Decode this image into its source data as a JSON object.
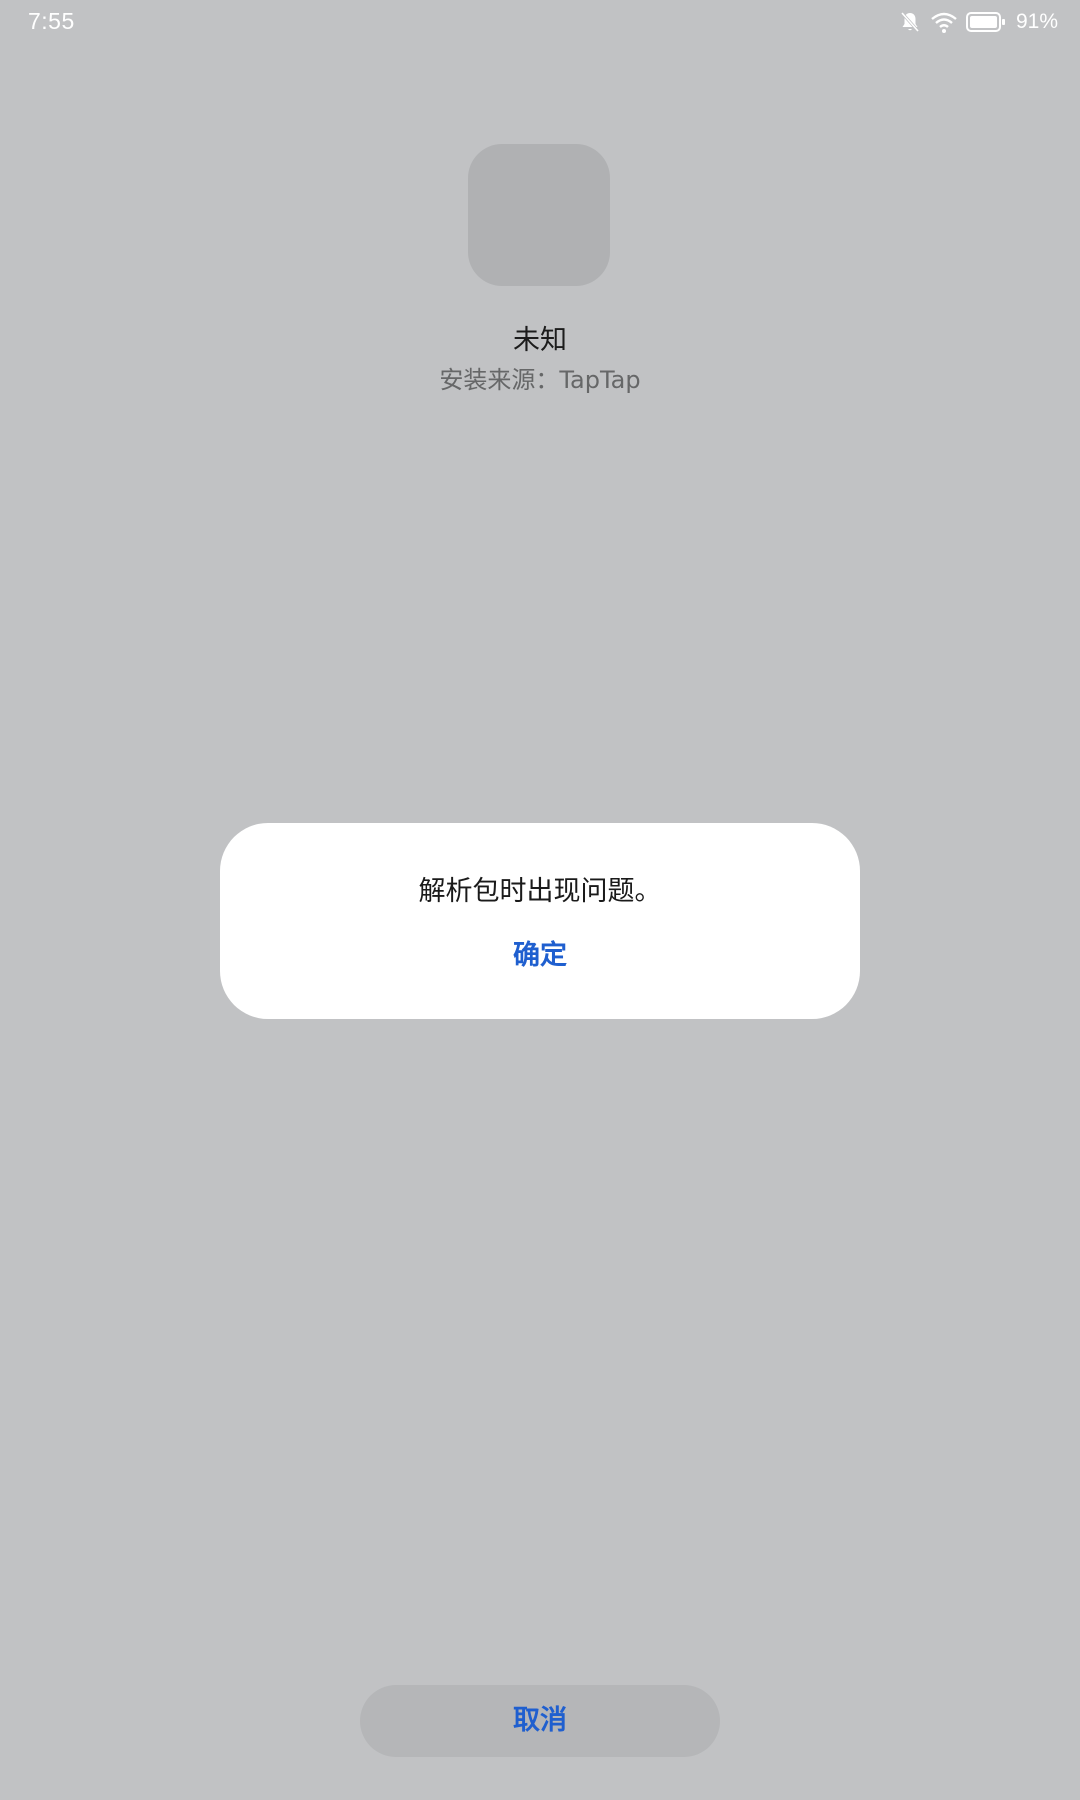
{
  "status_bar": {
    "time": "7:55",
    "battery_percent": "91%",
    "icons": [
      "bell-muted-icon",
      "wifi-icon",
      "battery-icon"
    ]
  },
  "app": {
    "name": "未知",
    "source": "安装来源：TapTap"
  },
  "dialog": {
    "message": "解析包时出现问题。",
    "confirm_label": "确定"
  },
  "footer": {
    "cancel_label": "取消"
  },
  "colors": {
    "background": "#c1c2c4",
    "accent": "#1f5fcf",
    "dialog_bg": "#ffffff"
  }
}
